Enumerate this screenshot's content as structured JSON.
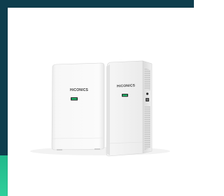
{
  "product": {
    "brand_text": "HiCONICS",
    "display_color": "#1fb86a",
    "frame_color": "#0e3d4d",
    "accent_color": "#2fcf9a"
  }
}
